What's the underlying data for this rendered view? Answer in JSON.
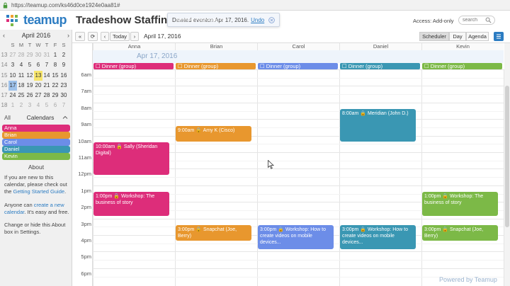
{
  "browser": {
    "url": "https://teamup.com/ks46d0ce1924e0aa81#"
  },
  "header": {
    "logo": "teamup",
    "calendar_title": "Tradeshow Staffing Ca",
    "notification": {
      "prefix": "Deleted event",
      "event": "Meeting Facebook, tim",
      "suffix": "on Apr 17, 2016.",
      "undo": "Undo"
    },
    "access": "Access: Add-only",
    "search_placeholder": "search"
  },
  "mini_calendar": {
    "month": "April 2016",
    "prev": "‹",
    "next": "›",
    "dow": [
      "S",
      "M",
      "T",
      "W",
      "T",
      "F",
      "S"
    ],
    "weeks": [
      {
        "wk": "13",
        "days": [
          "27",
          "28",
          "29",
          "30",
          "31",
          "1",
          "2"
        ]
      },
      {
        "wk": "14",
        "days": [
          "3",
          "4",
          "5",
          "6",
          "7",
          "8",
          "9"
        ]
      },
      {
        "wk": "15",
        "days": [
          "10",
          "11",
          "12",
          "13",
          "14",
          "15",
          "16"
        ]
      },
      {
        "wk": "16",
        "days": [
          "17",
          "18",
          "19",
          "20",
          "21",
          "22",
          "23"
        ]
      },
      {
        "wk": "17",
        "days": [
          "24",
          "25",
          "26",
          "27",
          "28",
          "29",
          "30"
        ]
      },
      {
        "wk": "18",
        "days": [
          "1",
          "2",
          "3",
          "4",
          "5",
          "6",
          "7"
        ]
      }
    ]
  },
  "calendars": {
    "all_label": "All",
    "heading": "Calendars",
    "items": [
      {
        "name": "Anna",
        "color": "#dd2d7a"
      },
      {
        "name": "Brian",
        "color": "#e8972e"
      },
      {
        "name": "Carol",
        "color": "#6c8de8"
      },
      {
        "name": "Daniel",
        "color": "#3a97b3"
      },
      {
        "name": "Kevin",
        "color": "#7cb947"
      }
    ]
  },
  "about": {
    "heading": "About",
    "p1_pre": "If you are new to this calendar, please check out the ",
    "p1_link": "Getting Started Guide",
    "p1_post": ".",
    "p2_pre": "Anyone can ",
    "p2_link": "create a new calendar",
    "p2_post": ". It's easy and free.",
    "p3": "Change or hide this About box in Settings."
  },
  "toolbar": {
    "collapse": "«",
    "refresh": "⟳",
    "prev": "‹",
    "today": "Today",
    "next": "›",
    "date": "April 17, 2016",
    "views": [
      "Scheduler",
      "Day",
      "Agenda"
    ]
  },
  "scheduler": {
    "date_band": "Apr 17, 2016",
    "columns": [
      "Anna",
      "Brian",
      "Carol",
      "Daniel",
      "Kevin"
    ],
    "all_day_label": "Dinner (group)",
    "hours": [
      "6am",
      "7am",
      "8am",
      "9am",
      "10am",
      "11am",
      "12pm",
      "1pm",
      "2pm",
      "3pm",
      "4pm",
      "5pm",
      "6pm"
    ],
    "events": [
      {
        "col": 0,
        "start": 10,
        "end": 12,
        "text": "10:00am 🔒 Sally (Sheridan Digital)"
      },
      {
        "col": 0,
        "start": 13,
        "end": 14.5,
        "text": "1:00pm 🔒 Workshop: The business of story"
      },
      {
        "col": 1,
        "start": 9,
        "end": 10,
        "text": "9:00am 🔒 Amy K (Cisco)"
      },
      {
        "col": 1,
        "start": 15,
        "end": 16,
        "text": "3:00pm 🔒 Snapchat (Joe, Berry)"
      },
      {
        "col": 2,
        "start": 15,
        "end": 16.5,
        "text": "3:00pm 🔒 Workshop: How to create videos on mobile devices..."
      },
      {
        "col": 3,
        "start": 8,
        "end": 10,
        "text": "8:00am 🔒 Meridian (John D.)"
      },
      {
        "col": 3,
        "start": 15,
        "end": 16.5,
        "text": "3:00pm 🔒 Workshop: How to create videos on mobile devices..."
      },
      {
        "col": 4,
        "start": 13,
        "end": 14.5,
        "text": "1:00pm 🔒 Workshop: The business of story"
      },
      {
        "col": 4,
        "start": 15,
        "end": 16,
        "text": "3:00pm 🔒 Snapchat (Joe, Berry)"
      }
    ]
  },
  "footer": {
    "powered": "Powered by Teamup"
  }
}
